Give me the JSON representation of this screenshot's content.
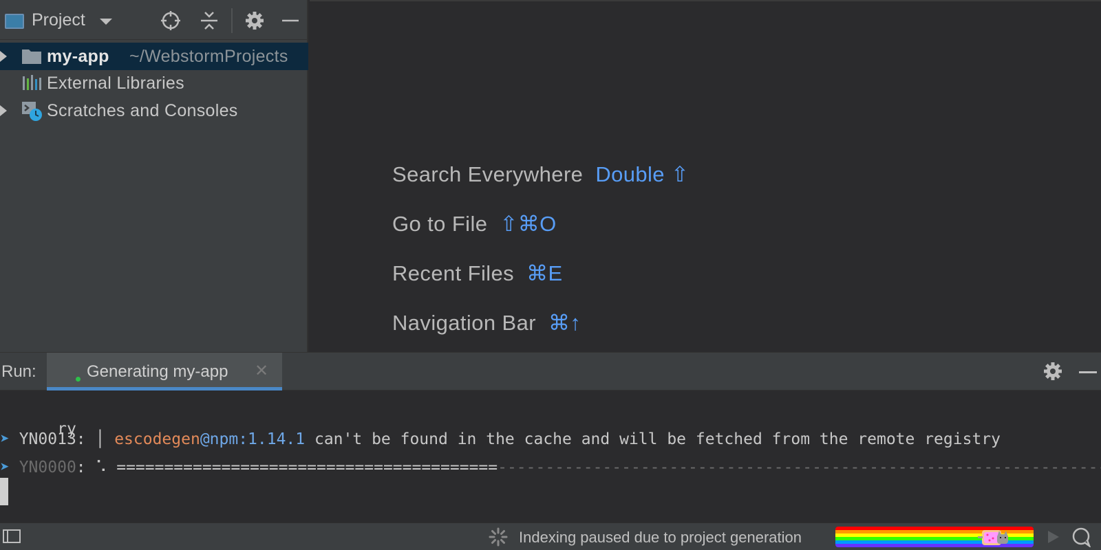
{
  "project_panel": {
    "title": "Project",
    "tree": [
      {
        "label": "my-app",
        "path": "~/WebstormProjects",
        "expandable": true,
        "selected": true,
        "icon": "folder-icon"
      },
      {
        "label": "External Libraries",
        "expandable": false,
        "icon": "library-icon"
      },
      {
        "label": "Scratches and Consoles",
        "expandable": true,
        "icon": "scratches-icon"
      }
    ]
  },
  "editor_hints": [
    {
      "name": "Search Everywhere",
      "key": "Double ⇧"
    },
    {
      "name": "Go to File",
      "key": "⇧⌘O"
    },
    {
      "name": "Recent Files",
      "key": "⌘E"
    },
    {
      "name": "Navigation Bar",
      "key": "⌘↑"
    }
  ],
  "run_panel": {
    "label": "Run:",
    "tab_label": "Generating my-app",
    "close_glyph": "✕",
    "console": {
      "line1": "ry",
      "line2": {
        "prompt": "➤",
        "code": " YN0013: │ ",
        "package": "escodegen",
        "version": "@npm:1.14.1",
        "message": " can't be found in the cache and will be fetched from the remote registry"
      },
      "line3": {
        "prompt": "➤",
        "code": " YN0000",
        "colon": ": ",
        "spinner": "⠡",
        "progress_done": "========================================",
        "progress_todo": "------------------------------------------------------------------"
      }
    }
  },
  "status_bar": {
    "text": "Indexing paused due to project generation",
    "progress_fraction": 0.8
  },
  "colors": {
    "accent": "#589df6",
    "package": "#e38a59",
    "tab_underline": "#4a88c7"
  }
}
